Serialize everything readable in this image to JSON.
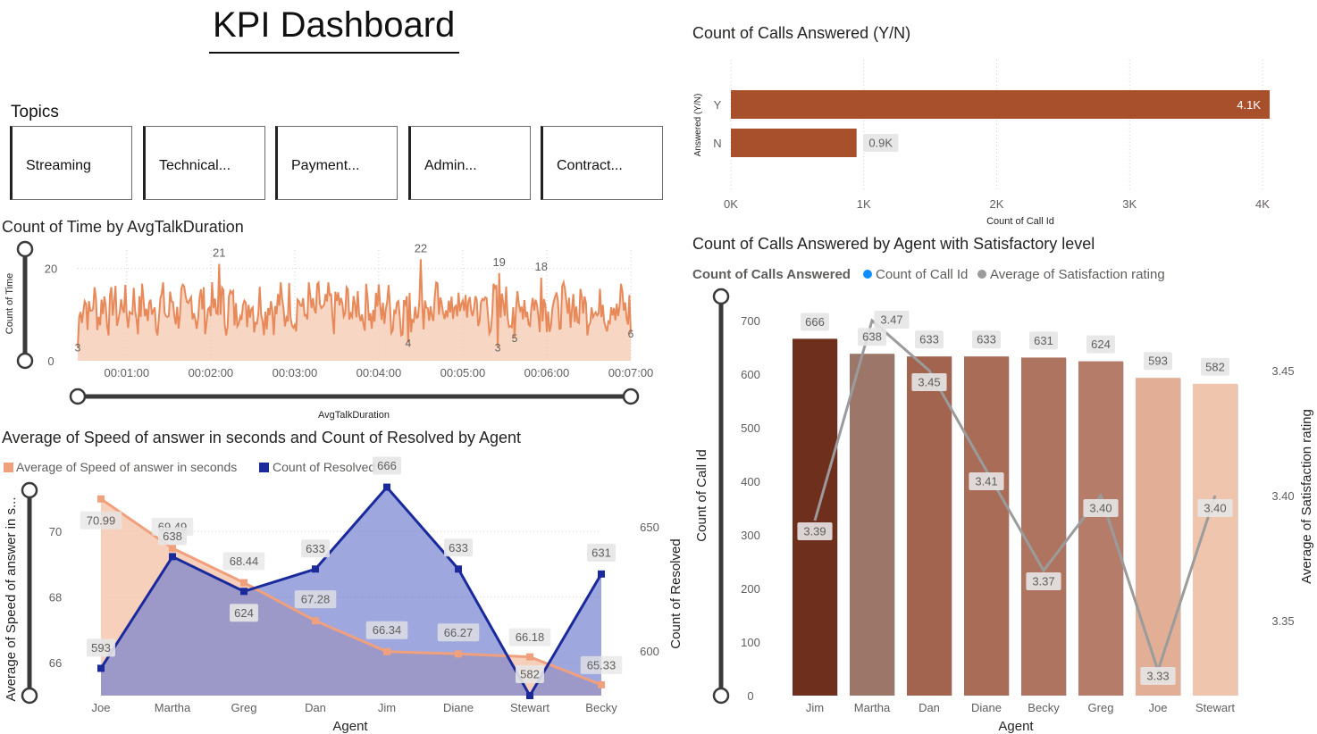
{
  "dashboard": {
    "title": "KPI Dashboard"
  },
  "topics": {
    "title": "Topics",
    "items": [
      "Streaming",
      "Technical...",
      "Payment...",
      "Admin...",
      "Contract..."
    ]
  },
  "colors": {
    "bar_answered": "#a8502c",
    "area_orange": "#e8895a",
    "area_fill": "#f6c8b0",
    "speed_line": "#f0a07d",
    "resolved_line": "#1a2a9c",
    "resolved_fill": "#6b7acc",
    "count_legend": "#118dff",
    "satisfaction": "#9b9b9b"
  },
  "chart_data": [
    {
      "id": "answered",
      "type": "bar",
      "orientation": "horizontal",
      "title": "Count of Calls Answered (Y/N)",
      "xlabel": "Count of Call Id",
      "ylabel": "Answered (Y/N)",
      "categories": [
        "Y",
        "N"
      ],
      "values": [
        4054,
        946
      ],
      "value_labels": [
        "4.1K",
        "0.9K"
      ],
      "xlim": [
        0,
        4000
      ],
      "xticks": [
        0,
        1000,
        2000,
        3000,
        4000
      ],
      "xtick_labels": [
        "0K",
        "1K",
        "2K",
        "3K",
        "4K"
      ],
      "grid": true
    },
    {
      "id": "talk",
      "type": "area",
      "title": "Count of Time by AvgTalkDuration",
      "xlabel": "AvgTalkDuration",
      "ylabel": "Count of Time",
      "ylim": [
        0,
        24
      ],
      "yticks": [
        0,
        20
      ],
      "xlim": [
        25,
        420
      ],
      "xtick_labels": [
        "00:01:00",
        "00:02:00",
        "00:03:00",
        "00:04:00",
        "00:05:00",
        "00:06:00",
        "00:07:00"
      ],
      "xtick_seconds": [
        60,
        120,
        180,
        240,
        300,
        360,
        420
      ],
      "seed": 7,
      "peaks": [
        {
          "x": 126,
          "y": 21,
          "label": "21"
        },
        {
          "x": 270,
          "y": 22,
          "label": "22"
        },
        {
          "x": 326,
          "y": 19,
          "label": "19"
        },
        {
          "x": 356,
          "y": 18,
          "label": "18"
        }
      ],
      "troughs": [
        {
          "x": 25,
          "y": 3,
          "label": "3"
        },
        {
          "x": 261,
          "y": 4,
          "label": "4"
        },
        {
          "x": 325,
          "y": 3,
          "label": "3"
        },
        {
          "x": 337,
          "y": 5,
          "label": "5"
        },
        {
          "x": 420,
          "y": 6,
          "label": "6"
        }
      ]
    },
    {
      "id": "speed",
      "type": "area",
      "title": "Average of Speed of answer in seconds and Count of Resolved by Agent",
      "xlabel": "Agent",
      "categories": [
        "Joe",
        "Martha",
        "Greg",
        "Dan",
        "Jim",
        "Diane",
        "Stewart",
        "Becky"
      ],
      "series": [
        {
          "name": "Average of Speed of answer in seconds",
          "axis": "left",
          "values": [
            70.99,
            69.49,
            68.44,
            67.28,
            66.34,
            66.27,
            66.18,
            65.33
          ],
          "labels": [
            "70.99",
            "69.49",
            "68.44",
            "67.28",
            "66.34",
            "66.27",
            "66.18",
            "65.33"
          ]
        },
        {
          "name": "Count of Resolved",
          "axis": "right",
          "values": [
            593,
            638,
            624,
            633,
            666,
            633,
            582,
            631
          ],
          "labels": [
            "593",
            "638",
            "624",
            "633",
            "666",
            "633",
            "582",
            "631"
          ]
        }
      ],
      "y_left": {
        "label": "Average of Speed of answer in s...",
        "lim": [
          65,
          71.5
        ],
        "ticks": [
          66,
          68,
          70
        ]
      },
      "y_right": {
        "label": "Count of Resolved",
        "lim": [
          582,
          668
        ],
        "ticks": [
          600,
          650
        ]
      }
    },
    {
      "id": "agent",
      "type": "bar",
      "title": "Count of Calls Answered by Agent with Satisfactory level",
      "legend_title": "Count of Calls Answered",
      "xlabel": "Agent",
      "categories": [
        "Jim",
        "Martha",
        "Dan",
        "Diane",
        "Becky",
        "Greg",
        "Joe",
        "Stewart"
      ],
      "series": [
        {
          "name": "Count of Call Id",
          "axis": "left",
          "values": [
            666,
            638,
            633,
            633,
            631,
            624,
            593,
            582
          ],
          "labels": [
            "666",
            "638",
            "633",
            "633",
            "631",
            "624",
            "593",
            "582"
          ]
        },
        {
          "name": "Average of Satisfaction rating",
          "axis": "right",
          "type": "line",
          "values": [
            3.39,
            3.47,
            3.45,
            3.41,
            3.37,
            3.4,
            3.33,
            3.4
          ],
          "labels": [
            "3.39",
            "3.47",
            "3.45",
            "3.41",
            "3.37",
            "3.40",
            "3.33",
            "3.40"
          ]
        }
      ],
      "y_left": {
        "label": "Count of Call Id",
        "lim": [
          0,
          700
        ],
        "ticks": [
          0,
          100,
          200,
          300,
          400,
          500,
          600,
          700
        ]
      },
      "y_right": {
        "label": "Average of Satisfaction rating",
        "lim": [
          3.32,
          3.47
        ],
        "ticks": [
          3.35,
          3.4,
          3.45
        ]
      },
      "bar_colors": [
        "#6f2f1d",
        "#9c7668",
        "#a3644f",
        "#a86c57",
        "#af7460",
        "#b47c69",
        "#e2ae95",
        "#f0c5ae"
      ],
      "shadow_color": "#d6d6d6"
    }
  ]
}
